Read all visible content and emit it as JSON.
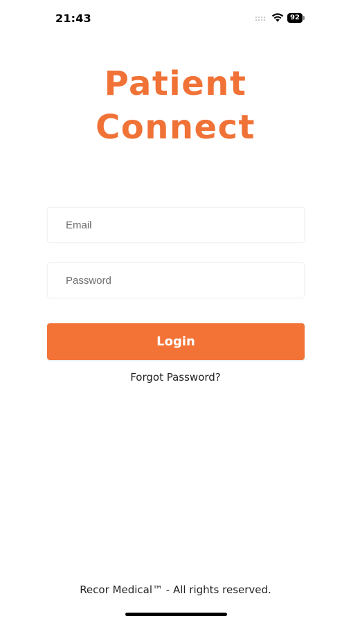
{
  "status_bar": {
    "time": "21:43",
    "battery_level": "92",
    "icons": [
      "signal-icon",
      "wifi-icon",
      "battery-icon"
    ]
  },
  "app": {
    "title_line1": "Patient",
    "title_line2": "Connect"
  },
  "login_form": {
    "email_placeholder": "Email",
    "email_value": "",
    "password_placeholder": "Password",
    "password_value": "",
    "login_label": "Login",
    "forgot_password_label": "Forgot Password?"
  },
  "footer": {
    "copyright": "Recor Medical™ - All rights reserved."
  },
  "colors": {
    "accent": "#f37337",
    "title": "#f07236",
    "background": "#ffffff"
  }
}
